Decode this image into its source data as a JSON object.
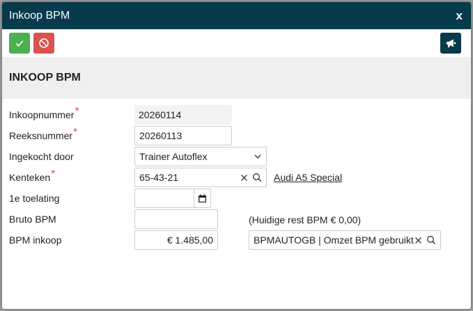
{
  "dialog": {
    "title": "Inkoop BPM",
    "close_label": "x"
  },
  "toolbar": {
    "ok_icon": "check-icon",
    "cancel_icon": "ban-icon",
    "announce_icon": "megaphone-icon"
  },
  "section": {
    "title": "INKOOP BPM"
  },
  "form": {
    "inkoopnummer_label": "Inkoopnummer",
    "inkoopnummer_value": "20260114",
    "reeksnummer_label": "Reeksnummer",
    "reeksnummer_value": "20260113",
    "ingekocht_door_label": "Ingekocht door",
    "ingekocht_door_value": "Trainer Autoflex",
    "kenteken_label": "Kenteken",
    "kenteken_value": "65-43-21",
    "kenteken_link": "Audi A5 Special",
    "toelating_label": "1e toelating",
    "toelating_value": "",
    "bruto_bpm_label": "Bruto BPM",
    "bruto_bpm_value": "",
    "rest_bpm_note": "(Huidige rest BPM € 0,00)",
    "bpm_inkoop_label": "BPM inkoop",
    "bpm_inkoop_value": "€ 1.485,00",
    "bpm_account_value": "BPMAUTOGB | Omzet BPM gebruikt"
  },
  "colors": {
    "titlebar": "#073a4b",
    "ok": "#4caf50",
    "cancel": "#d9534f",
    "required": "#d9534f"
  }
}
